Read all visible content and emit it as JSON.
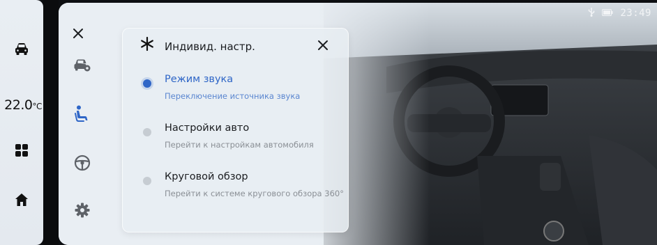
{
  "dock": {
    "temperature": "22.0",
    "temperature_unit": "°C",
    "icons": [
      "car-icon",
      "apps-grid-icon",
      "home-icon"
    ]
  },
  "status_bar": {
    "time": "23:49",
    "icons": [
      "usb-icon",
      "battery-icon"
    ]
  },
  "rail": {
    "icons": [
      "close-icon",
      "car-settings-icon",
      "seat-icon",
      "steering-wheel-icon",
      "gear-icon"
    ]
  },
  "card": {
    "title": "Индивид. настр.",
    "options": [
      {
        "title": "Режим звука",
        "subtitle": "Переключение источника звука",
        "selected": true
      },
      {
        "title": "Настройки авто",
        "subtitle": "Перейти к настройкам автомобиля",
        "selected": false
      },
      {
        "title": "Круговой обзор",
        "subtitle": "Перейти к системе кругового обзора 360°",
        "selected": false
      }
    ]
  },
  "colors": {
    "accent": "#2f66c7",
    "inactive_dot": "#c6ccd2"
  }
}
